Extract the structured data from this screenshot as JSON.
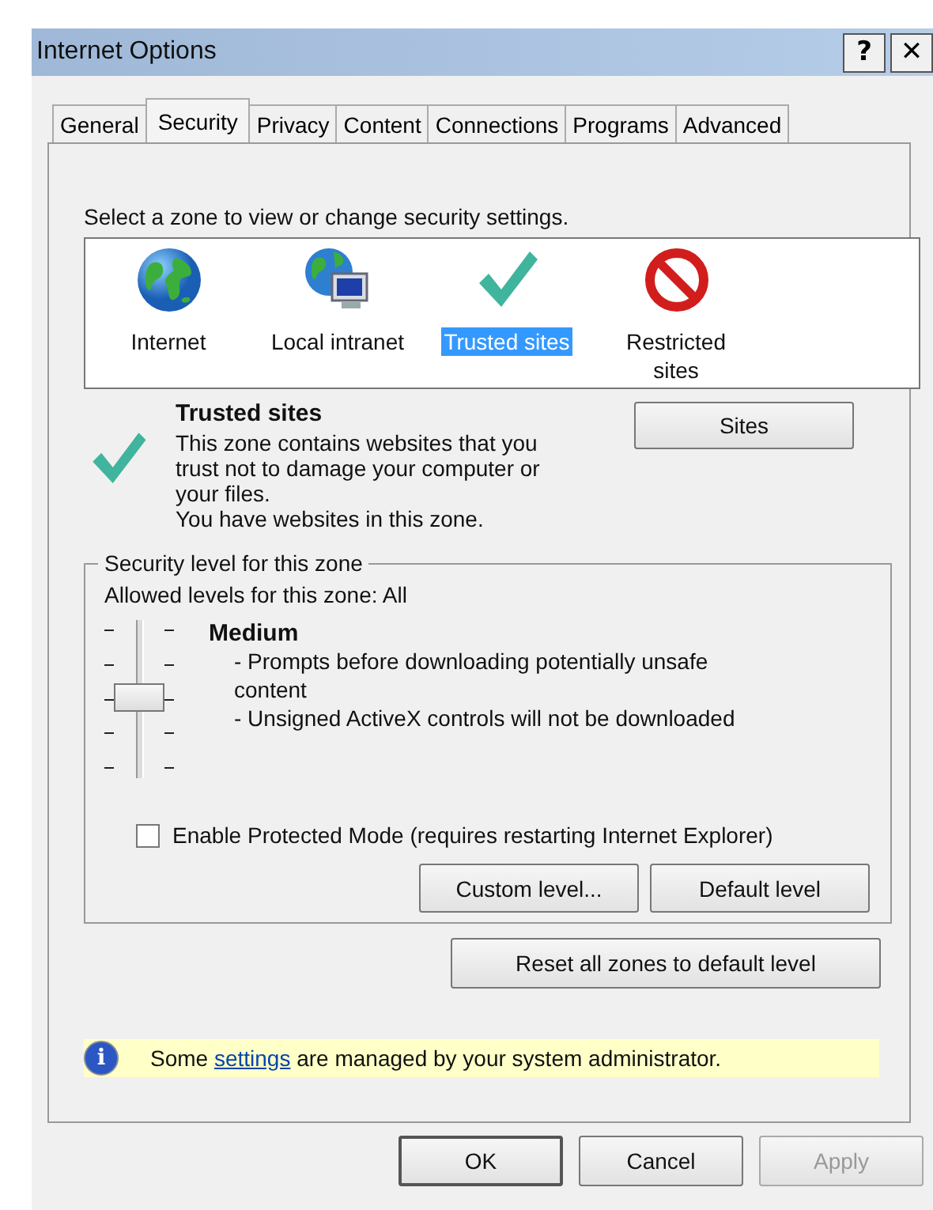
{
  "window": {
    "title": "Internet Options",
    "title_buttons": [
      "?",
      "✕"
    ]
  },
  "tabs": [
    {
      "label": "General",
      "selected": false
    },
    {
      "label": "Security",
      "selected": true
    },
    {
      "label": "Privacy",
      "selected": false
    },
    {
      "label": "Content",
      "selected": false
    },
    {
      "label": "Connections",
      "selected": false
    },
    {
      "label": "Programs",
      "selected": false
    },
    {
      "label": "Advanced",
      "selected": false
    }
  ],
  "zone_prompt": "Select a zone to view or change security settings.",
  "zones": [
    {
      "kind": "globe",
      "label": "Internet",
      "selected": false
    },
    {
      "kind": "globe-computer",
      "label": "Local intranet",
      "selected": false
    },
    {
      "kind": "check",
      "label": "Trusted sites",
      "selected": true
    },
    {
      "kind": "blocked",
      "label": "Restricted sites",
      "selected": false
    }
  ],
  "zone_info": {
    "title": "Trusted sites",
    "description": "This zone contains websites that you trust not to damage your computer or your files.",
    "note": "You have websites in this zone.",
    "button": "Sites"
  },
  "security_level": {
    "legend": "Security level for this zone",
    "allowed": "Allowed levels for this zone: All",
    "level": 0.5,
    "level_name": "Medium",
    "details": [
      "- Prompts before downloading potentially unsafe content",
      "- Unsigned ActiveX controls will not be downloaded"
    ],
    "protected_mode": {
      "label": "Enable Protected Mode (requires restarting Internet Explorer)",
      "checked": false
    },
    "buttons": [
      "Custom level...",
      "Default level"
    ]
  },
  "reset_button": "Reset all zones to default level",
  "info_bar": {
    "icon": "i",
    "before": "Some ",
    "link": "settings",
    "after": " are managed by your system administrator."
  },
  "dialog_buttons": [
    {
      "label": "OK",
      "disabled": false,
      "default": true
    },
    {
      "label": "Cancel",
      "disabled": false,
      "default": false
    },
    {
      "label": "Apply",
      "disabled": true,
      "default": false
    }
  ]
}
